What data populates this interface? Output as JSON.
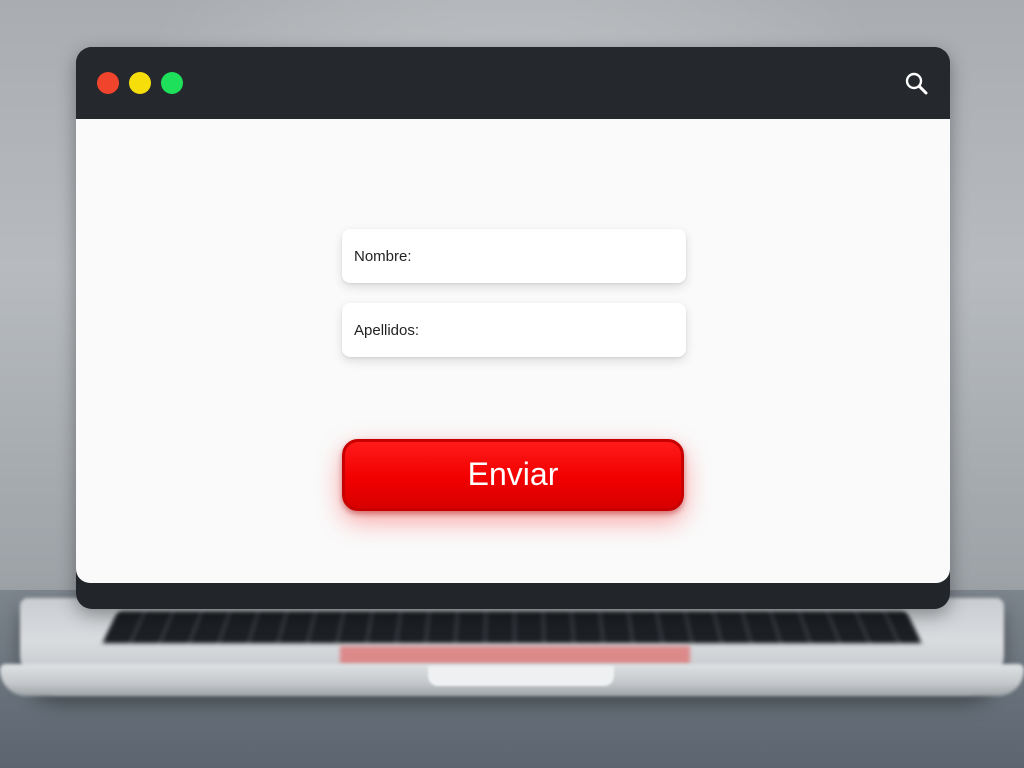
{
  "window": {
    "controls": {
      "close_color": "#f0442c",
      "minimize_color": "#f5de0a",
      "maximize_color": "#1ee05a"
    },
    "search_icon": "search-icon"
  },
  "form": {
    "fields": [
      {
        "label": "Nombre:",
        "value": ""
      },
      {
        "label": "Apellidos:",
        "value": ""
      }
    ],
    "submit_label": "Enviar",
    "submit_color": "#f20000"
  }
}
